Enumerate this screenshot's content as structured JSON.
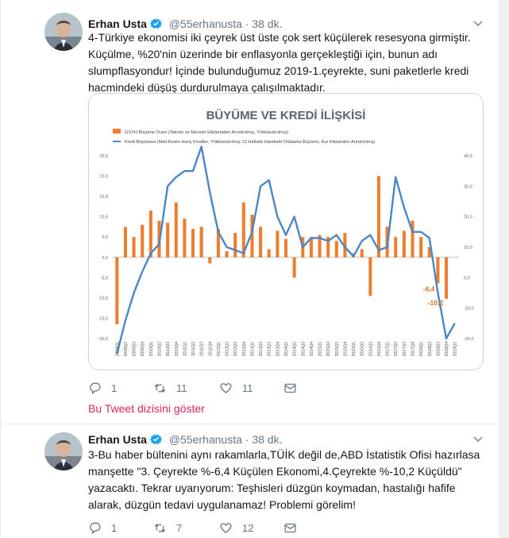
{
  "tweets": [
    {
      "display_name": "Erhan Usta",
      "handle": "@55erhanusta",
      "time": "38 dk.",
      "text": "4-Türkiye ekonomisi iki çeyrek üst üste çok sert küçülerek resesyona girmiştir. Küçülme, %20'nin üzerinde bir enflasyonla gerçekleştiği için, bunun adı slumpflasyondur! İçinde bulunduğumuz 2019-1.çeyrekte, suni paketlerle kredi hacmindeki düşüş durdurulmaya çalışılmaktadır.",
      "replies": "1",
      "retweets": "11",
      "likes": "11",
      "show_thread": "Bu Tweet dizisini göster"
    },
    {
      "display_name": "Erhan Usta",
      "handle": "@55erhanusta",
      "time": "38 dk.",
      "text": "3-Bu haber bültenini aynı rakamlarla,TÜİK değil de,ABD İstatistik Ofisi hazırlasa manşette \"3. Çeyrekte %-6,4 Küçülen Ekonomi,4.Çeyrekte %-10,2 Küçüldü\" yazacaktı. Tekrar uyarıyorum: Teşhisleri düzgün koymadan, hastalığı hafife alarak, düzgün tedavi uygulanamaz! Problemi görelim!",
      "replies": "1",
      "retweets": "7",
      "likes": "12"
    }
  ],
  "colors": {
    "bar": "#f07d2e",
    "line": "#4a86c8",
    "link": "#e0245e",
    "text": "#14171a",
    "muted": "#657786"
  },
  "chart_data": {
    "type": "bar",
    "title": "BÜYÜME VE KREDİ İLİŞKİSİ",
    "legend": [
      "GSYH Büyüme Oranı (Takvim ve Mevsim Etkilerinden Arındırılmış, Yıllıklandırılmış)",
      "Kredi Büyümesi (Mali Kesim Hariç Krediler, Yıllıklandırılmış 13 Haftalık Hareketli Ortalama Büyüme, Kur Etkisinden Arındırılmış)"
    ],
    "categories": [
      "2009Q1",
      "2009Q2",
      "2009Q3",
      "2009Q4",
      "2010Q1",
      "2010Q2",
      "2010Q3",
      "2010Q4",
      "2011Q1",
      "2011Q2",
      "2011Q3",
      "2011Q4",
      "2012Q1",
      "2012Q2",
      "2012Q3",
      "2012Q4",
      "2013Q1",
      "2013Q2",
      "2013Q3",
      "2013Q4",
      "2014Q1",
      "2014Q2",
      "2014Q3",
      "2014Q4",
      "2015Q1",
      "2015Q2",
      "2015Q3",
      "2015Q4",
      "2016Q1",
      "2016Q2",
      "2016Q3",
      "2016Q4",
      "2017Q1",
      "2017Q2",
      "2017Q3",
      "2017Q4",
      "2018Q1",
      "2018Q2",
      "2018Q3",
      "2018Q4",
      "2019Q1"
    ],
    "series": [
      {
        "name": "GSYH Büyüme Oranı",
        "values": [
          -16.5,
          7.5,
          5.0,
          8.0,
          11.5,
          9.0,
          8.5,
          13.5,
          9.5,
          7.0,
          7.5,
          -1.5,
          7.0,
          1.5,
          6.0,
          13.5,
          10.5,
          7.5,
          2.0,
          6.5,
          4.5,
          -5.0,
          5.0,
          5.0,
          5.5,
          5.0,
          4.0,
          6.0,
          1.0,
          2.0,
          -9.5,
          20.0,
          7.5,
          5.0,
          6.5,
          9.0,
          5.0,
          2.5,
          -6.4,
          -10.2,
          null
        ]
      },
      {
        "name": "Kredi Büyümesi",
        "values": [
          -25,
          -14,
          -5,
          2,
          8,
          11,
          30,
          33,
          35,
          35,
          43,
          28,
          15,
          10,
          9,
          8,
          15,
          30,
          32,
          20,
          14,
          20,
          10,
          13,
          13,
          12,
          14,
          10,
          7,
          12,
          14,
          9,
          10,
          33,
          23,
          15,
          15,
          13,
          -5,
          -20,
          -15
        ]
      }
    ],
    "y_left": {
      "min": -20,
      "max": 25,
      "ticks": [
        "25,0",
        "20,0",
        "15,0",
        "10,0",
        "5,0",
        "0,0",
        "-5,0",
        "-10,0",
        "-15,0",
        "-20,0"
      ]
    },
    "y_right": {
      "min": -20,
      "max": 40,
      "ticks": [
        "40,0",
        "30,0",
        "20,0",
        "10,0",
        "0,0",
        "-10,0",
        "-20,0"
      ]
    },
    "annotations": [
      "-6,4",
      "-10,2"
    ]
  }
}
